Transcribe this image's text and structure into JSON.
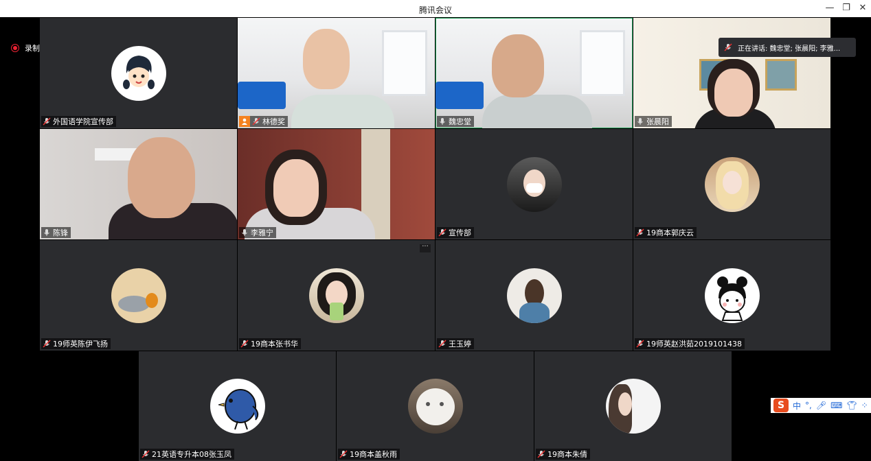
{
  "window": {
    "title": "腾讯会议",
    "minimize_icon": "minimize-icon",
    "restore_icon": "restore-icon",
    "close_icon": "close-icon"
  },
  "recording": {
    "label": "录制中"
  },
  "speaking": {
    "text": "正在讲话: 魏忠堂; 张晨阳; 李雅..."
  },
  "participants": [
    {
      "name": "外国语学院宣传部",
      "mic": "muted",
      "kind": "avatar"
    },
    {
      "name": "林德奖",
      "mic": "muted",
      "kind": "video",
      "host": true
    },
    {
      "name": "魏忠堂",
      "mic": "on",
      "kind": "video"
    },
    {
      "name": "张晨阳",
      "mic": "on",
      "kind": "video"
    },
    {
      "name": "陈锋",
      "mic": "on",
      "kind": "video"
    },
    {
      "name": "李雅宁",
      "mic": "on",
      "kind": "video"
    },
    {
      "name": "宣传部",
      "mic": "muted",
      "kind": "avatar"
    },
    {
      "name": "19商本郭庆云",
      "mic": "muted",
      "kind": "avatar"
    },
    {
      "name": "19师英陈伊飞扬",
      "mic": "muted",
      "kind": "avatar"
    },
    {
      "name": "19商本张书华",
      "mic": "muted",
      "kind": "avatar"
    },
    {
      "name": "王玉婷",
      "mic": "muted",
      "kind": "avatar"
    },
    {
      "name": "19师英赵洪茹2019101438",
      "mic": "muted",
      "kind": "avatar"
    },
    {
      "name": "21英语专升本08张玉凤",
      "mic": "muted",
      "kind": "avatar"
    },
    {
      "name": "19商本盖秋雨",
      "mic": "muted",
      "kind": "avatar"
    },
    {
      "name": "19商本朱倩",
      "mic": "muted",
      "kind": "avatar"
    }
  ],
  "more_label": "···",
  "ime": {
    "logo": "S",
    "mode": "中",
    "items": [
      "°,",
      "mic-icon",
      "keyboard-icon",
      "shirt-icon",
      "grid-icon"
    ]
  },
  "colors": {
    "tile_bg": "#2b2c2f",
    "speaking_border": "#22a35a",
    "host_badge": "#f5821f",
    "record_red": "#e22233"
  }
}
